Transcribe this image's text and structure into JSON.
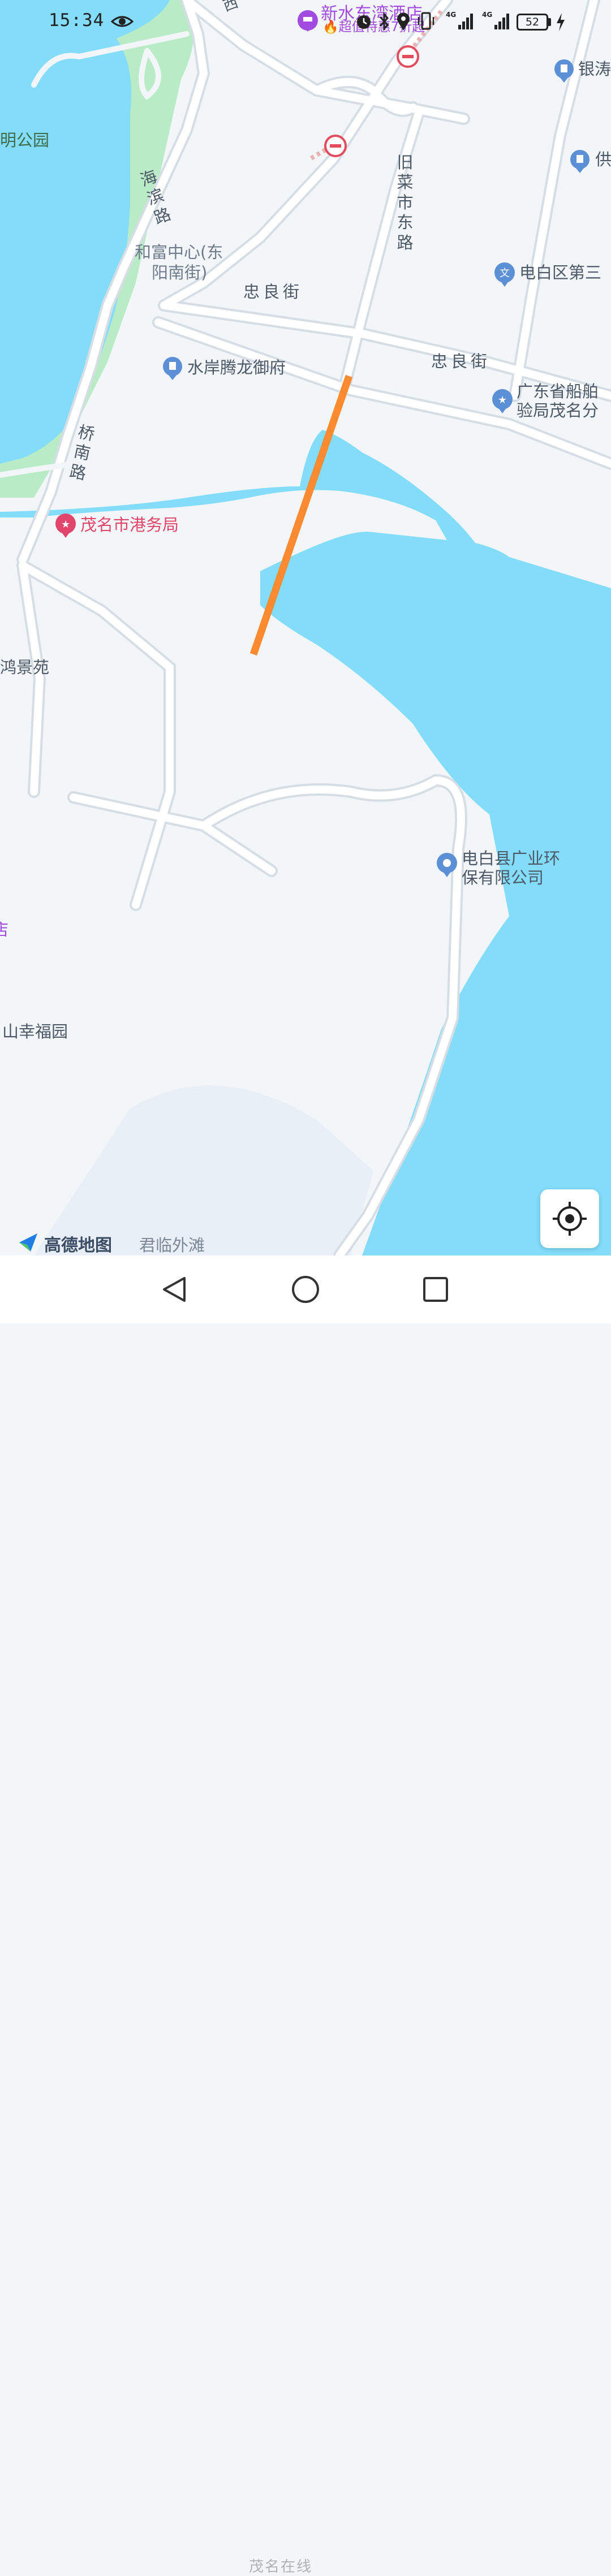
{
  "status_bar": {
    "time": "15:34",
    "battery": "52",
    "icons": [
      "eye-icon",
      "alarm-icon",
      "bluetooth-icon",
      "location-icon",
      "vibrate-icon",
      "signal-4g-icon",
      "signal-4g-icon",
      "charging-icon"
    ]
  },
  "map": {
    "colors": {
      "land": "#f3f6f9",
      "water": "#82dcfa",
      "park": "#b9ebc6",
      "road_edge": "#d6dde5",
      "road": "#ffffff",
      "route": "#fb8a30",
      "pin_blue": "#5b8fd6",
      "pin_pink": "#e2456b",
      "pin_purple": "#a24be0"
    },
    "labels": {
      "hotel_name": "新水东湾酒店",
      "hotel_promo": "🔥超值特惠7折起",
      "yin_tao": "银涛",
      "gong": "供",
      "park": "明公园",
      "haibin_road": "海滨路",
      "jiucai_road": "旧菜市东路",
      "hefu_line1": "和富中心(东",
      "hefu_line2": "阳南街)",
      "zhongliang_1": "忠良街",
      "zhongliang_2": "忠良街",
      "dianbai_school": "电白区第三",
      "shuian": "水岸腾龙御府",
      "chuanbo_line1": "广东省船舶",
      "chuanbo_line2": "验局茂名分",
      "qiaonan_road": "桥南路",
      "port_bureau": "茂名市港务局",
      "hongjing": "鸿景苑",
      "guangye_line1": "电白县广业环",
      "guangye_line2": "保有限公司",
      "edge_char": "店",
      "xingfu": "山幸福园",
      "junlin": "君临外滩",
      "west_char": "西"
    },
    "icons": [
      "no-entry-icon",
      "building-pin-icon",
      "school-pin-icon",
      "star-pin-icon",
      "location-pin-icon",
      "hotel-pin-icon"
    ]
  },
  "controls": {
    "locate_icon": "locate-crosshair-icon"
  },
  "logo": {
    "text": "高德地图"
  },
  "navbar": {
    "icons": [
      "back-icon",
      "home-icon",
      "recents-icon"
    ]
  },
  "watermark": "茂名在线"
}
